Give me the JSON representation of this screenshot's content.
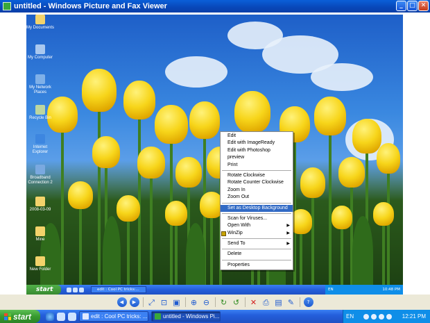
{
  "window": {
    "title": "untitled - Windows Picture and Fax Viewer",
    "buttons": {
      "minimize": "_",
      "maximize": "□",
      "close": "✕"
    }
  },
  "desktop_icons": [
    {
      "label": "My Documents",
      "icon": "folder-documents-icon",
      "color": "#f3d36b"
    },
    {
      "label": "My Computer",
      "icon": "computer-icon",
      "color": "#a9c8ef"
    },
    {
      "label": "My Network Places",
      "icon": "network-icon",
      "color": "#7fb0e8"
    },
    {
      "label": "Recycle Bin",
      "icon": "recycle-bin-icon",
      "color": "#bcd6a0"
    },
    {
      "label": "Internet Explorer",
      "icon": "ie-icon",
      "color": "#3d86e0"
    },
    {
      "label": "Broadband Connection 2",
      "icon": "connection-icon",
      "color": "#7aa9e0"
    },
    {
      "label": "2008-03-09",
      "icon": "folder-icon",
      "color": "#f3d36b"
    },
    {
      "label": "Mine",
      "icon": "folder-icon",
      "color": "#f3d36b"
    },
    {
      "label": "New Folder",
      "icon": "folder-icon",
      "color": "#f3d36b"
    }
  ],
  "context_menu": {
    "groups": [
      [
        "Edit",
        "Edit with ImageReady",
        "Edit with Photoshop",
        "preview",
        "Print"
      ],
      [
        "Rotate Clockwise",
        "Rotate Counter Clockwise",
        "Zoom In",
        "Zoom Out"
      ],
      [
        "Set as Desktop Background"
      ],
      [
        "Scan for Viruses...",
        "Open With",
        "WinZip"
      ],
      [
        "Send To"
      ],
      [
        "Delete"
      ],
      [
        "Properties"
      ]
    ],
    "highlighted": "Set as Desktop Background",
    "submenu_items": [
      "Open With",
      "WinZip",
      "Send To"
    ],
    "submenu_arrow": "▶"
  },
  "inner_taskbar": {
    "start_label": "start",
    "task_label": "edit : Cool PC tricks:...",
    "lang": "EN",
    "clock": "10:48 PM"
  },
  "toolbar": {
    "buttons": [
      {
        "name": "previous-image-button",
        "icon": "◀",
        "style": "round"
      },
      {
        "name": "next-image-button",
        "icon": "▶",
        "style": "round"
      },
      {
        "sep": true
      },
      {
        "name": "best-fit-button",
        "icon": "⤢",
        "style": "blue"
      },
      {
        "name": "actual-size-button",
        "icon": "⊡",
        "style": "blue"
      },
      {
        "name": "slideshow-button",
        "icon": "▣",
        "style": "blue"
      },
      {
        "sep": true
      },
      {
        "name": "zoom-in-button",
        "icon": "⊕",
        "style": "blue"
      },
      {
        "name": "zoom-out-button",
        "icon": "⊖",
        "style": "blue"
      },
      {
        "sep": true
      },
      {
        "name": "rotate-clockwise-button",
        "icon": "↻",
        "style": "green"
      },
      {
        "name": "rotate-counterclockwise-button",
        "icon": "↺",
        "style": "green"
      },
      {
        "sep": true
      },
      {
        "name": "delete-button",
        "icon": "✕",
        "style": "red"
      },
      {
        "name": "print-button",
        "icon": "⎙",
        "style": "blue"
      },
      {
        "name": "save-button",
        "icon": "▤",
        "style": "blue"
      },
      {
        "name": "open-editor-button",
        "icon": "✎",
        "style": "blue"
      },
      {
        "sep": true
      },
      {
        "name": "help-button",
        "icon": "?",
        "style": "round"
      }
    ]
  },
  "taskbar": {
    "start_label": "start",
    "tasks": [
      {
        "label": "edit : Cool PC tricks: ...",
        "active": false
      },
      {
        "label": "untitled - Windows Pi...",
        "active": true
      }
    ],
    "lang": "EN",
    "clock": "12:21 PM"
  }
}
